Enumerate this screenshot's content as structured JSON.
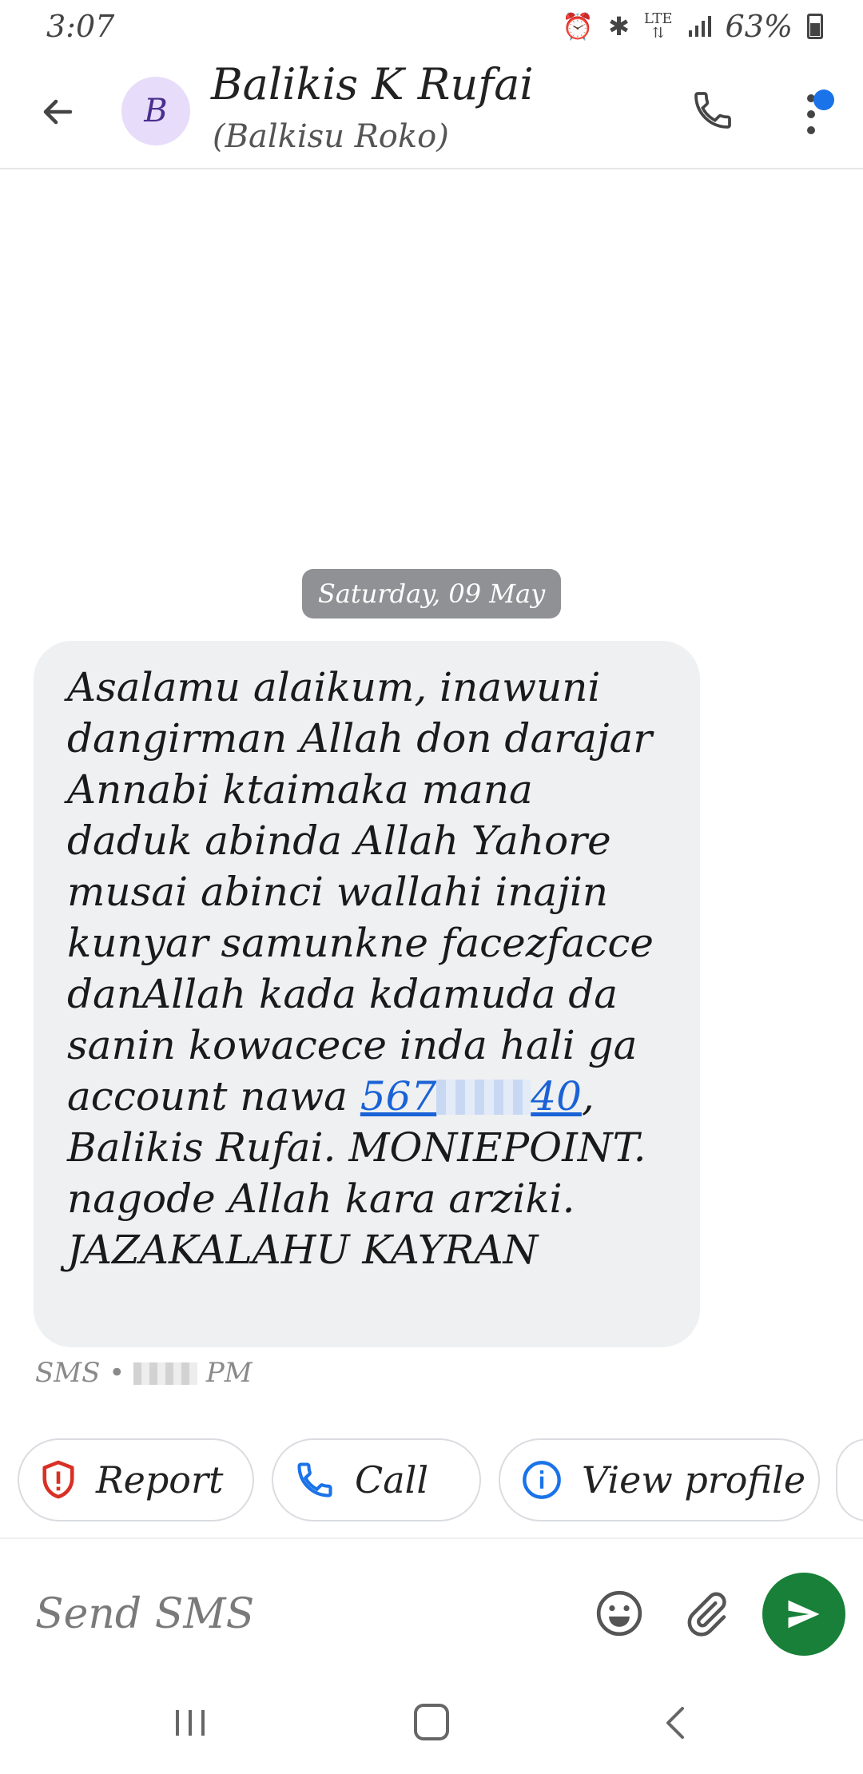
{
  "status_bar": {
    "time": "3:07",
    "lte": "LTE",
    "battery": "63%"
  },
  "header": {
    "avatar_letter": "B",
    "contact_name": "Balikis K Rufai",
    "contact_subtitle": "(Balkisu Roko)"
  },
  "conversation": {
    "date_label": "Saturday, 09 May",
    "message": {
      "text_before_link": "Asalamu alaikum, inawuni dangirman Allah don darajar Annabi ktaimaka mana daduk abinda Allah Yahore musai abinci wallahi inajin kunyar samunkne facezfacce danAllah kada kdamuda da sanin kowacece inda hali ga account nawa ",
      "link_prefix": "567",
      "link_suffix": "40",
      "text_after_link": ", Balikis Rufai. MONIEPOINT. nagode Allah kara arziki. JAZAKALAHU KAYRAN",
      "meta_prefix": "SMS •",
      "meta_suffix": "PM"
    }
  },
  "suggestion_chips": {
    "report": "Report",
    "call": "Call",
    "view_profile": "View profile"
  },
  "compose": {
    "placeholder": "Send SMS"
  },
  "colors": {
    "accent_blue": "#1a73e8",
    "send_green": "#188038",
    "report_red": "#d93025",
    "bubble_bg": "#eef0f1"
  }
}
